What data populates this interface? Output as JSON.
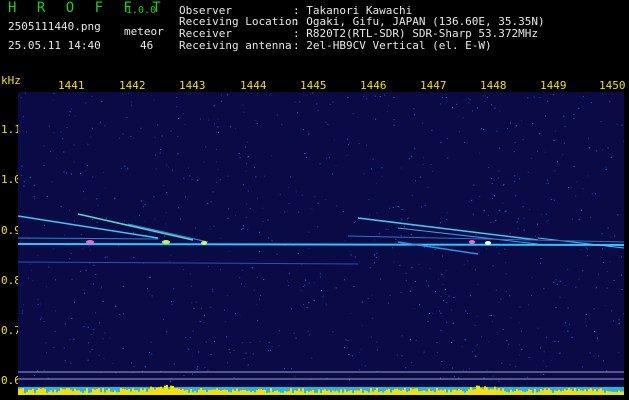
{
  "header": {
    "logo": "H R O F F T",
    "version": "1.0.0",
    "filename": "2505111440.png",
    "datetime": "25.05.11 14:40",
    "meteor_label": "meteor",
    "meteor_count": "46",
    "info": [
      {
        "label": "Observer",
        "value": ": Takanori Kawachi"
      },
      {
        "label": "Receiving Location",
        "value": ": Ogaki, Gifu, JAPAN (136.60E, 35.35N)"
      },
      {
        "label": "Receiver",
        "value": ": R820T2(RTL-SDR) SDR-Sharp 53.372MHz"
      },
      {
        "label": "Receiving antenna",
        "value": ": 2el-HB9CV Vertical (el. E-W)"
      }
    ]
  },
  "axes": {
    "y_unit": "kHz",
    "y_ticks": [
      "1.1",
      "1.0",
      "0.9",
      "0.8",
      "0.7",
      "0.6"
    ],
    "x_ticks": [
      "1441",
      "1442",
      "1443",
      "1444",
      "1445",
      "1446",
      "1447",
      "1448",
      "1449",
      "1450"
    ]
  },
  "colors": {
    "background": "#000000",
    "plot_bg": "#0a0a46",
    "text_green": "#19d219",
    "text_white": "#e8e8e8",
    "axis_yellow": "#f3e100",
    "signal_cyan": "#28c8ff",
    "signal_pink": "#ff64c8"
  }
}
